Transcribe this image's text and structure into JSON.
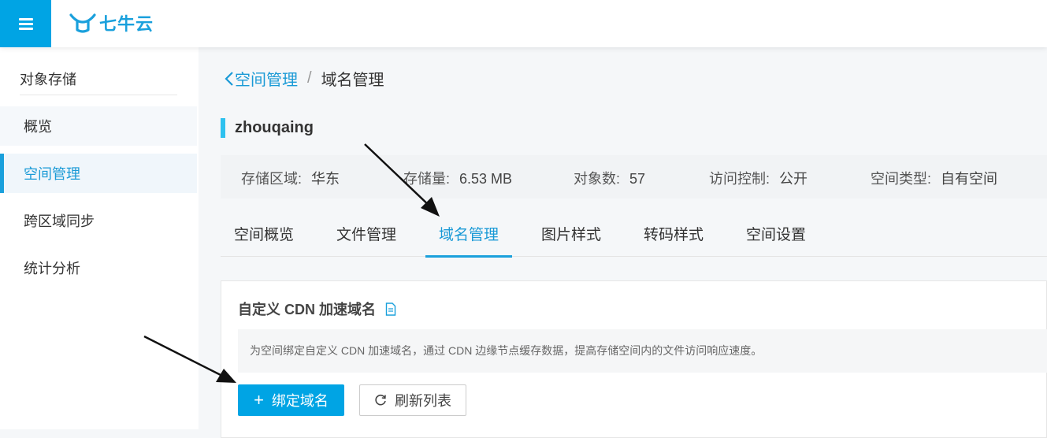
{
  "header": {
    "logo_text": "七牛云",
    "brand_color": "#00a4e4"
  },
  "sidebar": {
    "title": "对象存储",
    "items": [
      {
        "label": "概览"
      },
      {
        "label": "空间管理"
      },
      {
        "label": "跨区域同步"
      },
      {
        "label": "统计分析"
      }
    ]
  },
  "breadcrumb": {
    "back": "空间管理",
    "separator": "/",
    "current": "域名管理"
  },
  "bucket": {
    "name": "zhouqaing",
    "info": [
      {
        "label": "存储区域:",
        "value": "华东"
      },
      {
        "label": "存储量:",
        "value": "6.53 MB"
      },
      {
        "label": "对象数:",
        "value": "57"
      },
      {
        "label": "访问控制:",
        "value": "公开"
      },
      {
        "label": "空间类型:",
        "value": "自有空间"
      }
    ]
  },
  "tabs": [
    {
      "label": "空间概览"
    },
    {
      "label": "文件管理"
    },
    {
      "label": "域名管理",
      "active": true
    },
    {
      "label": "图片样式"
    },
    {
      "label": "转码样式"
    },
    {
      "label": "空间设置"
    }
  ],
  "panel": {
    "title": "自定义 CDN 加速域名",
    "notice": "为空间绑定自定义 CDN 加速域名，通过 CDN 边缘节点缓存数据，提高存储空间内的文件访问响应速度。",
    "bind_button": "绑定域名",
    "refresh_button": "刷新列表"
  },
  "icons": {
    "menu": "hamburger-icon",
    "back": "chevron-left-icon",
    "doc": "document-icon",
    "plus": "plus-icon",
    "refresh": "refresh-icon"
  }
}
